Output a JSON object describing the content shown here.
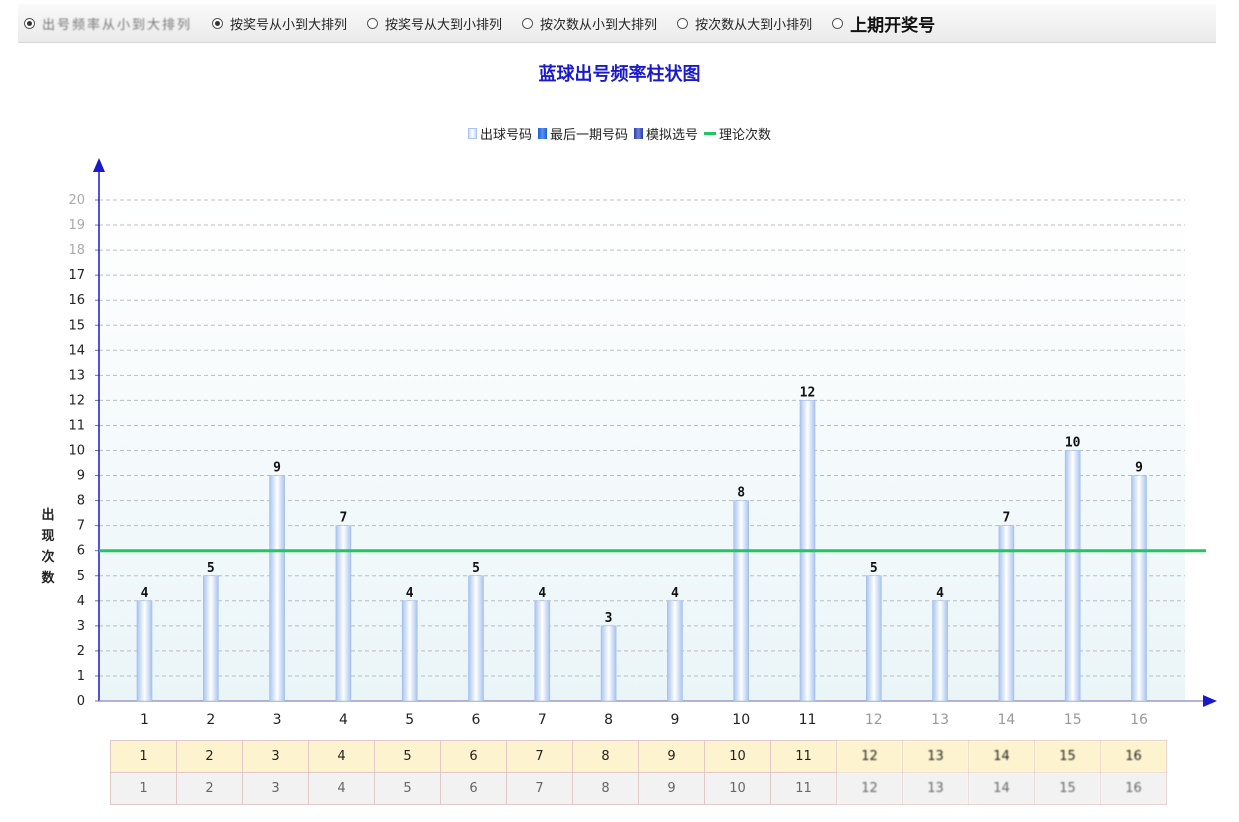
{
  "options": [
    {
      "label": "出号频率从小到大排列",
      "selected": true,
      "blurred": true
    },
    {
      "label": "按奖号从小到大排列",
      "selected": true
    },
    {
      "label": "按奖号从大到小排列",
      "selected": false
    },
    {
      "label": "按次数从小到大排列",
      "selected": false
    },
    {
      "label": "按次数从大到小排列",
      "selected": false
    },
    {
      "label": "上期开奖号",
      "selected": false,
      "strong": true
    }
  ],
  "chart_data": {
    "type": "bar",
    "title": "蓝球出号频率柱状图",
    "ylabel": "出现次数",
    "xlabel": "",
    "categories": [
      "1",
      "2",
      "3",
      "4",
      "5",
      "6",
      "7",
      "8",
      "9",
      "10",
      "11",
      "12",
      "13",
      "14",
      "15",
      "16"
    ],
    "series": [
      {
        "name": "出球号码",
        "values": [
          4,
          5,
          9,
          7,
          4,
          5,
          4,
          3,
          4,
          8,
          12,
          5,
          4,
          7,
          10,
          9
        ]
      },
      {
        "name": "最后一期号码",
        "values": []
      },
      {
        "name": "模拟选号",
        "values": []
      },
      {
        "name": "理论次数",
        "values": [
          6,
          6,
          6,
          6,
          6,
          6,
          6,
          6,
          6,
          6,
          6,
          6,
          6,
          6,
          6,
          6
        ]
      }
    ],
    "reference_line": 6,
    "ylim": [
      0,
      20
    ],
    "yticks": [
      0,
      1,
      2,
      3,
      4,
      5,
      6,
      7,
      8,
      9,
      10,
      11,
      12,
      13,
      14,
      15,
      16,
      17,
      18,
      19,
      20
    ],
    "grid": true,
    "legend_position": "top-center",
    "colors": {
      "bar": "#c9dbf6",
      "bar_edge": "#9fbcec",
      "line": "#22c55e",
      "axis": "#1a1acc",
      "title": "#1a1acc"
    }
  },
  "table": {
    "row1": [
      "1",
      "2",
      "3",
      "4",
      "5",
      "6",
      "7",
      "8",
      "9",
      "10",
      "11",
      "12",
      "13",
      "14",
      "15",
      "16"
    ],
    "row2": [
      "1",
      "2",
      "3",
      "4",
      "5",
      "6",
      "7",
      "8",
      "9",
      "10",
      "11",
      "12",
      "13",
      "14",
      "15",
      "16"
    ]
  }
}
